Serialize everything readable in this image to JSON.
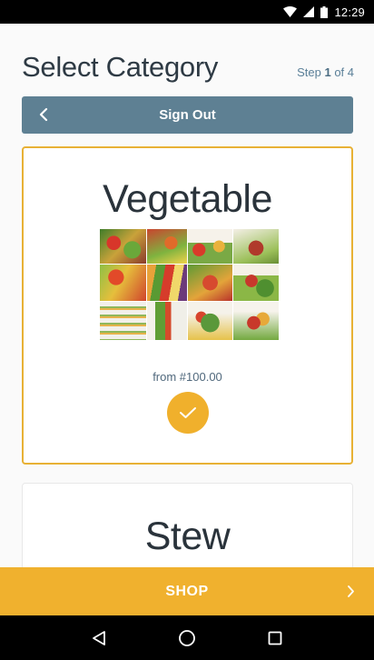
{
  "status_bar": {
    "time": "12:29",
    "icons": [
      "wifi-icon",
      "signal-icon",
      "battery-icon"
    ]
  },
  "header": {
    "title": "Select Category",
    "step_prefix": "Step ",
    "step_current": "1",
    "step_suffix": " of 4"
  },
  "signout": {
    "label": "Sign Out",
    "icon": "chevron-left-icon"
  },
  "categories": [
    {
      "title": "Vegetable",
      "price": "from #100.00",
      "selected": true,
      "check_icon": "check-icon"
    },
    {
      "title": "Stew",
      "selected": false
    }
  ],
  "shop": {
    "label": "SHOP",
    "icon": "chevron-right-icon"
  },
  "navbar": {
    "icons": [
      "back-triangle-icon",
      "home-circle-icon",
      "recents-square-icon"
    ]
  },
  "colors": {
    "accent": "#f0b12e",
    "signout_bar": "#5e8093",
    "title_text": "#2e3a44",
    "step_text": "#5a7f98"
  }
}
